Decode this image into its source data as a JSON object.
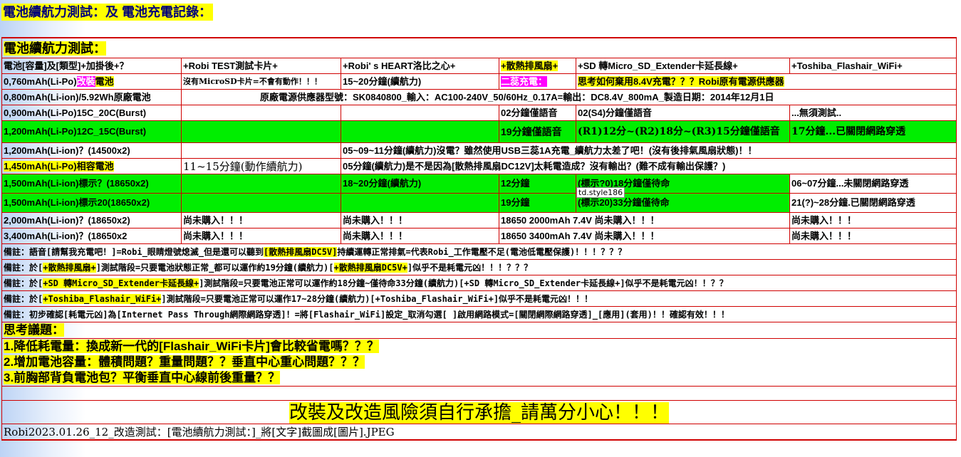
{
  "page_title": "電池續航力測試：及 電池充電記錄：",
  "section_title": "電池續航力測試：",
  "header": [
    "電池[容量]及[類型]+加掛後+？",
    "+Robi TEST測試卡片+",
    "+Robi' s HEART洛比之心+",
    "+散熱排風扇+",
    "+SD 轉Micro_SD_Extender卡延長線+",
    "+Toshiba_Flashair_WiFi+"
  ],
  "rows": {
    "r760": {
      "c0a": "0,760mAh(Li-Po)",
      "c0b": "改裝",
      "c0c": "電池",
      "c1": "沒有MicroSD卡片=不會有動作！！！",
      "c2": "15~20分鐘(續航力)",
      "c3": "二蕊充電：",
      "c4": "思考如何棄用8.4V充電？？？Robi原有電源供應器"
    },
    "r800": {
      "c0": "0,800mAh(Li-ion)/5.92Wh原廠電池",
      "span": "原廠電源供應器型號：SK0840800_輸入：AC100-240V_50/60Hz_0.17A=輸出：DC8.4V_800mA_製造日期：2014年12月1日"
    },
    "r900": {
      "c0": "0,900mAh(Li-Po)15C_20C(Burst)",
      "c3": "02分鐘僅語音",
      "c4": "02(S4)分鐘僅語音",
      "c5": "...無須測試.."
    },
    "r1200a": {
      "c0": "1,200mAh(Li-Po)12C_15C(Burst)",
      "c3": "19分鐘僅語音",
      "c4": "(R1)12分~(R2)18分~(R3)15分鐘僅語音",
      "c5": "17分鐘...已關閉網路穿透"
    },
    "r1200b": {
      "c0": "1,200mAh(Li-ion)？(14500x2)",
      "span": "05~09~11分鐘(續航力)沒電？雖然使用USB三蕊1A充電_續航力太差了吧！(沒有後排氣風扇狀態)！！"
    },
    "r1450": {
      "c0": "1,450mAh(Li-Po)相容電池",
      "c1": "11~15分鐘(動作續航力)",
      "span": "05分鐘(續航力)是不是因為[散熱排風扇DC12V]太耗電造成？沒有輸出？(難不成有輸出保護？)"
    },
    "r1500a": {
      "c0": "1,500mAh(Li-ion)標示？(18650x2)",
      "c2": "18~20分鐘(續航力)",
      "c3": "12分鐘",
      "c4": "(標示?0)18分鐘僅待命",
      "c5": "06~07分鐘...未關閉網路穿透"
    },
    "r1500b": {
      "c0": "1,500mAh(Li-ion)標示20(18650x2)",
      "c3": "19分鐘",
      "c4": "(標示20)33分鐘僅待命",
      "c5": "21(?)~28分鐘.已關閉網路穿透"
    },
    "r2000": {
      "c0": "2,000mAh(Li-ion)？(18650x2)",
      "c1": "尚未購入！！！",
      "c2": "尚未購入！！！",
      "c34": "18650 2000mAh 7.4V 尚未購入！！！",
      "c5": "尚未購入！！！"
    },
    "r3400": {
      "c0": "3,400mAh(Li-ion)？(18650x2",
      "c1": "尚未購入！！！",
      "c2": "尚未購入！！！",
      "c34": "18650 3400mAh 7.4V 尚未購入！！！",
      "c5": "尚未購入！！！"
    }
  },
  "notes": {
    "n1a": "備註：語音[請幫我充電吧！]=Robi_眼睛燈號熄滅_但是還可以聽到",
    "n1b": "[散熱排風扇DC5V]",
    "n1c": "持續運轉正常排氣=代表Robi_工作電壓不足(電池低電壓保護)！！！？？？",
    "n2a": "備註：於[",
    "n2b": "+散熱排風扇+",
    "n2c": "]測試階段=只要電池狀態正常_都可以運作約19分鐘(續航力)[",
    "n2d": "+散熱排風扇DC5V+",
    "n2e": "]似乎不是耗電元凶！！！？？？",
    "n3a": "備註：於[",
    "n3b": "+SD 轉Micro_SD_Extender卡延長線+",
    "n3c": "]測試階段=只要電池正常可以運作約18分鐘~僅待命33分鐘(續航力)[+SD 轉Micro_SD_Extender卡延長線+]似乎不是耗電元凶！！？？",
    "n4a": "備註：於[",
    "n4b": "+Toshiba_Flashair_WiFi+",
    "n4c": "]測試階段=只要電池正常可以運作17~28分鐘(續航力)[+Toshiba_Flashair_WiFi+]似乎不是耗電元凶！！！",
    "n5a": "備註：初步確認[耗電元凶]為[Internet Pass Through網際網路穿透]！=",
    "n5b": "將[Flashair_WiFi]設定_取消勾選[ ]啟用網路模式=[關閉網際網路穿透]_[應用](套用)！！確認有效！！！"
  },
  "think": {
    "title": "思考議題：",
    "items": [
      "1.降低耗電量：換成新一代的[Flashair_WiFi卡片]會比較省電嗎？？？",
      "2.增加電池容量：體積問題？重量問題？？垂直中心重心問題？？？",
      "3.前胸部背負電池包？平衡垂直中心線前後重量？？"
    ]
  },
  "warning": "改裝及改造風險須自行承擔_請萬分小心！！！",
  "footer": "Robi2023.01.26_12_改造測試：[電池續航力測試：]_將[文字]截圖成[圖片].JPEG",
  "tooltip": "td.style186",
  "colors": {
    "border": "#d00000",
    "green": "#00ee00",
    "yellow": "#ffff00",
    "magenta": "#ff00ff"
  }
}
